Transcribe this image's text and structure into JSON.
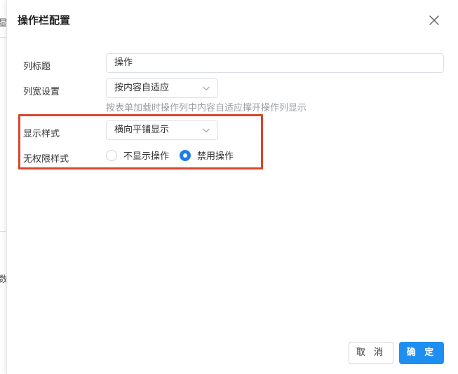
{
  "background": {
    "fragment_1": "显",
    "fragment_2": "数"
  },
  "dialog": {
    "title": "操作栏配置",
    "close_icon": "close-icon",
    "fields": {
      "column_title": {
        "label": "列标题",
        "value": "操作"
      },
      "column_width": {
        "label": "列宽设置",
        "value": "按内容自适应",
        "hint": "按表单加载时操作列中内容自适应撑开操作列显示"
      },
      "display_style": {
        "label": "显示样式",
        "value": "横向平铺显示"
      },
      "no_permission_style": {
        "label": "无权限样式",
        "options": [
          {
            "label": "不显示操作",
            "selected": false
          },
          {
            "label": "禁用操作",
            "selected": true
          }
        ]
      }
    },
    "footer": {
      "cancel_label": "取 消",
      "confirm_label": "确 定"
    },
    "colors": {
      "primary": "#1e8ff0",
      "highlight_border": "#d9452b"
    }
  }
}
